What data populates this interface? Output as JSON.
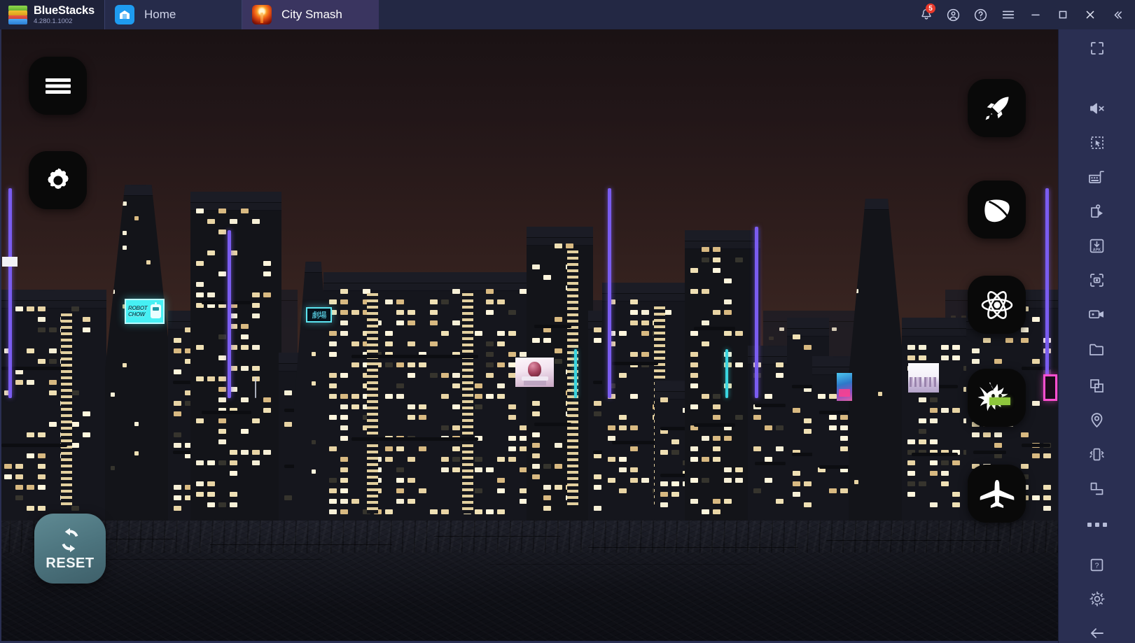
{
  "app": {
    "brand_name": "BlueStacks",
    "version": "4.280.1.1002",
    "logo_icon": "bluestacks-logo-icon"
  },
  "tabs": [
    {
      "label": "Home",
      "icon": "home-icon",
      "active": false
    },
    {
      "label": "City Smash",
      "icon": "city-smash-app-icon",
      "active": true
    }
  ],
  "titlebar_buttons": [
    {
      "name": "notifications-button",
      "icon": "bell-icon",
      "badge": "5"
    },
    {
      "name": "account-button",
      "icon": "account-circle-icon",
      "badge": ""
    },
    {
      "name": "help-button",
      "icon": "question-circle-icon",
      "badge": ""
    },
    {
      "name": "menu-button",
      "icon": "hamburger-menu-icon",
      "badge": ""
    },
    {
      "name": "minimize-button",
      "icon": "minimize-icon",
      "badge": ""
    },
    {
      "name": "maximize-button",
      "icon": "maximize-icon",
      "badge": ""
    },
    {
      "name": "close-button",
      "icon": "close-icon",
      "badge": ""
    },
    {
      "name": "collapse-sidebar-button",
      "icon": "double-chevron-left-icon",
      "badge": ""
    }
  ],
  "game": {
    "title": "City Smash",
    "hud_left": [
      {
        "name": "game-menu-button",
        "icon": "hamburger-menu-icon"
      },
      {
        "name": "game-settings-button",
        "icon": "gear-icon"
      }
    ],
    "hud_right": [
      {
        "name": "missile-tool-button",
        "icon": "rocket-icon"
      },
      {
        "name": "tornado-tool-button",
        "icon": "leaf-icon"
      },
      {
        "name": "nuke-tool-button",
        "icon": "atom-icon"
      },
      {
        "name": "monster-tool-button",
        "icon": "monster-icon"
      },
      {
        "name": "airplane-tool-button",
        "icon": "airplane-icon"
      }
    ],
    "reset": {
      "label": "RESET",
      "icon": "refresh-arrows-icon"
    },
    "billboards": [
      {
        "name": "billboard-robot-chow",
        "text_line1": "ROBOT",
        "text_line2": "CHOW"
      },
      {
        "name": "billboard-kanji",
        "text": "劇場"
      }
    ],
    "colors": {
      "sky_top": "#1a1214",
      "sky_mid": "#4a2f27",
      "building": "#15161d",
      "window_warm": "#efe0b4",
      "neon_violet": "#7a5cf0",
      "neon_cyan": "#3ad5e0",
      "ground": "#0f1016"
    }
  },
  "sidebar": {
    "items": [
      {
        "name": "fullscreen-button",
        "icon": "fullscreen-icon"
      },
      {
        "name": "mute-button",
        "icon": "speaker-mute-icon"
      },
      {
        "name": "multi-select-button",
        "icon": "marquee-cursor-icon"
      },
      {
        "name": "keymapping-button",
        "icon": "keyboard-icon"
      },
      {
        "name": "macro-recorder-button",
        "icon": "macro-play-icon"
      },
      {
        "name": "install-apk-button",
        "icon": "apk-download-icon"
      },
      {
        "name": "screenshot-button",
        "icon": "camera-icon"
      },
      {
        "name": "record-screen-button",
        "icon": "video-camera-icon"
      },
      {
        "name": "media-manager-button",
        "icon": "folder-icon"
      },
      {
        "name": "multi-instance-button",
        "icon": "copy-windows-icon"
      },
      {
        "name": "location-button",
        "icon": "map-pin-icon"
      },
      {
        "name": "shake-button",
        "icon": "shake-phone-icon"
      },
      {
        "name": "rotate-button",
        "icon": "rotate-screen-icon"
      },
      {
        "name": "more-tools-button",
        "icon": "ellipsis-icon"
      },
      {
        "name": "help-button",
        "icon": "question-box-icon"
      },
      {
        "name": "settings-button",
        "icon": "gear-icon"
      },
      {
        "name": "back-button",
        "icon": "arrow-left-icon"
      }
    ]
  }
}
